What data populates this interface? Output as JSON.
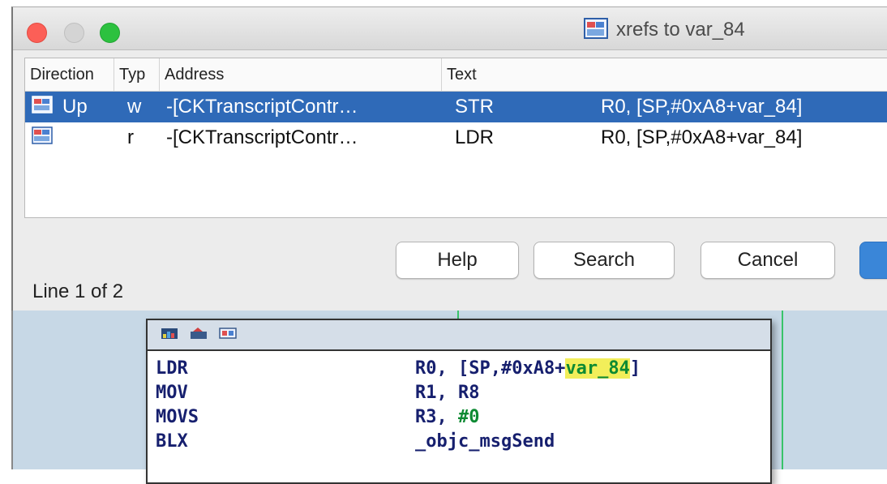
{
  "window": {
    "title": "xrefs to var_84",
    "title_icon": "xref-list-icon"
  },
  "table": {
    "columns": [
      "Direction",
      "Typ",
      "Address",
      "Text"
    ],
    "rows": [
      {
        "direction": "Up",
        "type": "w",
        "address": "-[CKTranscriptContr…",
        "op": "STR",
        "args": "R0, [SP,#0xA8+var_84]",
        "selected": true
      },
      {
        "direction": "",
        "type": "r",
        "address": "-[CKTranscriptContr…",
        "op": "LDR",
        "args": "R0, [SP,#0xA8+var_84]",
        "selected": false
      }
    ]
  },
  "buttons": {
    "help": "Help",
    "search": "Search",
    "cancel": "Cancel",
    "ok": ""
  },
  "status": "Line 1 of 2",
  "code": {
    "lines": [
      {
        "op": "LDR",
        "args_prefix": "R0, [SP,#0xA8+",
        "highlight": "var_84",
        "args_suffix": "]"
      },
      {
        "op": "MOV",
        "args": "R1, R8"
      },
      {
        "op": "MOVS",
        "args_prefix": "R3, ",
        "number": "#0"
      },
      {
        "op": "BLX",
        "args": "_objc_msgSend"
      }
    ]
  },
  "colors": {
    "selection": "#2f6ab8",
    "highlight": "#f2ee5a",
    "graph_bg": "#c7d8e6",
    "close": "#fc5f57",
    "maximize": "#2cc13f"
  }
}
